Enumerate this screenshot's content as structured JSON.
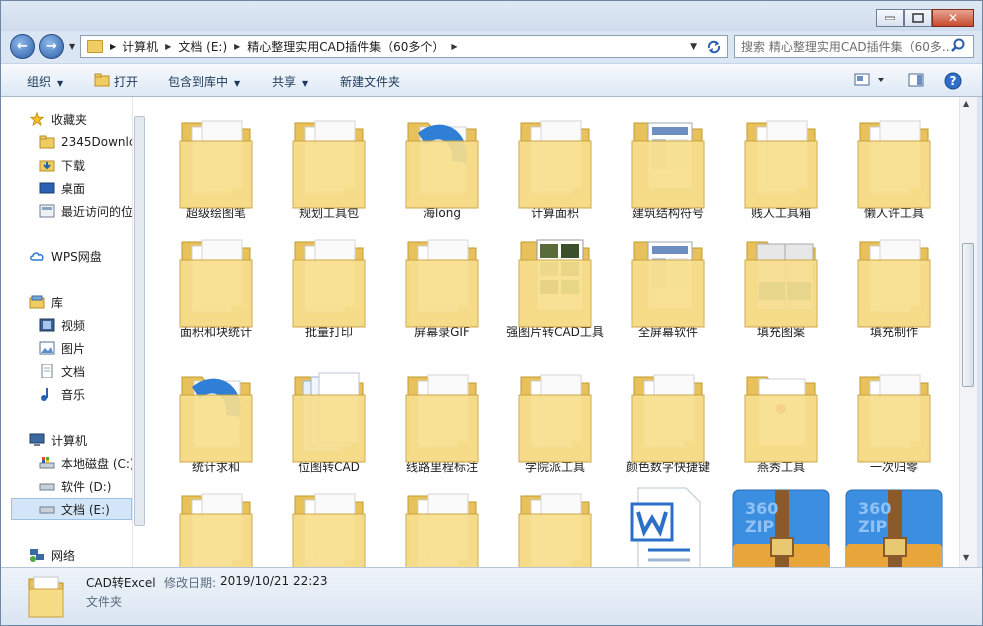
{
  "address": {
    "crumbs": [
      "计算机",
      "文档 (E:)",
      "精心整理实用CAD插件集（60多个）"
    ]
  },
  "search": {
    "placeholder": "搜索 精心整理实用CAD插件集（60多..."
  },
  "toolbar": {
    "organize": "组织",
    "open": "打开",
    "include_library": "包含到库中",
    "share": "共享",
    "new_folder": "新建文件夹"
  },
  "nav": {
    "favorites": "收藏夹",
    "fav_items": [
      "2345Downlc",
      "下载",
      "桌面",
      "最近访问的位"
    ],
    "wps": "WPS网盘",
    "libraries": "库",
    "lib_items": [
      "视频",
      "图片",
      "文档",
      "音乐"
    ],
    "computer": "计算机",
    "drives": [
      "本地磁盘 (C:)",
      "软件 (D:)",
      "文档 (E:)"
    ],
    "network": "网络"
  },
  "items": [
    {
      "label": "超级绘图笔",
      "icon": "folder-docs"
    },
    {
      "label": "规划工具包",
      "icon": "folder-docs"
    },
    {
      "label": "海long",
      "icon": "folder-arc"
    },
    {
      "label": "计算面积",
      "icon": "folder-docs"
    },
    {
      "label": "建筑结构符号",
      "icon": "folder-screenshot"
    },
    {
      "label": "贱人工具箱",
      "icon": "folder-docs"
    },
    {
      "label": "懒人许工具",
      "icon": "folder-docs"
    },
    {
      "label": "面积和块统计",
      "icon": "folder-docs"
    },
    {
      "label": "批量打印",
      "icon": "folder-docs"
    },
    {
      "label": "屏幕录GIF",
      "icon": "folder-docs"
    },
    {
      "label": "强图片转CAD工具",
      "icon": "folder-photos"
    },
    {
      "label": "全屏幕软件",
      "icon": "folder-screenshot"
    },
    {
      "label": "填充图案",
      "icon": "folder-pattern"
    },
    {
      "label": "填充制作",
      "icon": "folder-docs"
    },
    {
      "label": "统计求和",
      "icon": "folder-arc"
    },
    {
      "label": "位图转CAD",
      "icon": "folder-stack"
    },
    {
      "label": "线路里程标注",
      "icon": "folder-docs"
    },
    {
      "label": "学院派工具",
      "icon": "folder-docs"
    },
    {
      "label": "颜色数字快捷键",
      "icon": "folder-docs"
    },
    {
      "label": "燕秀工具",
      "icon": "folder-red"
    },
    {
      "label": "一次归零",
      "icon": "folder-docs"
    },
    {
      "label": "",
      "icon": "folder-docs"
    },
    {
      "label": "",
      "icon": "folder-docs"
    },
    {
      "label": "",
      "icon": "folder-docs"
    },
    {
      "label": "",
      "icon": "folder-docs"
    },
    {
      "label": "",
      "icon": "word-doc"
    },
    {
      "label": "",
      "icon": "zip-archive"
    },
    {
      "label": "",
      "icon": "zip-archive"
    }
  ],
  "zip_text": "360\nZIP",
  "status": {
    "name": "CAD转Excel",
    "modified_label": "修改日期:",
    "modified": "2019/10/21 22:23",
    "type": "文件夹"
  }
}
